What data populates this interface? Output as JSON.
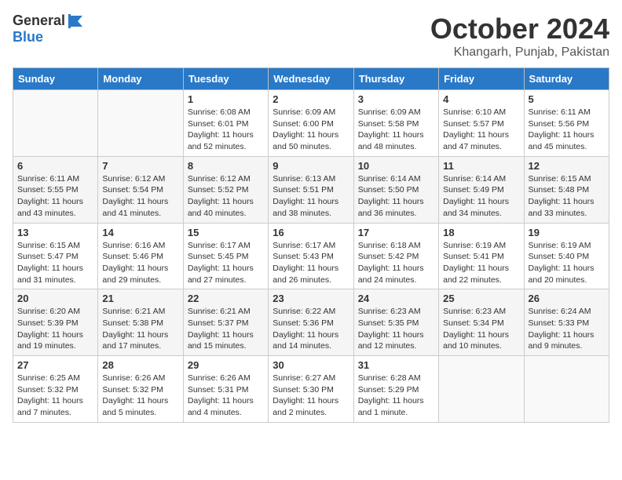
{
  "header": {
    "logo_general": "General",
    "logo_blue": "Blue",
    "month_title": "October 2024",
    "subtitle": "Khangarh, Punjab, Pakistan"
  },
  "days_of_week": [
    "Sunday",
    "Monday",
    "Tuesday",
    "Wednesday",
    "Thursday",
    "Friday",
    "Saturday"
  ],
  "weeks": [
    [
      {
        "day": "",
        "sunrise": "",
        "sunset": "",
        "daylight": "",
        "empty": true
      },
      {
        "day": "",
        "sunrise": "",
        "sunset": "",
        "daylight": "",
        "empty": true
      },
      {
        "day": "1",
        "sunrise": "Sunrise: 6:08 AM",
        "sunset": "Sunset: 6:01 PM",
        "daylight": "Daylight: 11 hours and 52 minutes.",
        "empty": false
      },
      {
        "day": "2",
        "sunrise": "Sunrise: 6:09 AM",
        "sunset": "Sunset: 6:00 PM",
        "daylight": "Daylight: 11 hours and 50 minutes.",
        "empty": false
      },
      {
        "day": "3",
        "sunrise": "Sunrise: 6:09 AM",
        "sunset": "Sunset: 5:58 PM",
        "daylight": "Daylight: 11 hours and 48 minutes.",
        "empty": false
      },
      {
        "day": "4",
        "sunrise": "Sunrise: 6:10 AM",
        "sunset": "Sunset: 5:57 PM",
        "daylight": "Daylight: 11 hours and 47 minutes.",
        "empty": false
      },
      {
        "day": "5",
        "sunrise": "Sunrise: 6:11 AM",
        "sunset": "Sunset: 5:56 PM",
        "daylight": "Daylight: 11 hours and 45 minutes.",
        "empty": false
      }
    ],
    [
      {
        "day": "6",
        "sunrise": "Sunrise: 6:11 AM",
        "sunset": "Sunset: 5:55 PM",
        "daylight": "Daylight: 11 hours and 43 minutes.",
        "empty": false
      },
      {
        "day": "7",
        "sunrise": "Sunrise: 6:12 AM",
        "sunset": "Sunset: 5:54 PM",
        "daylight": "Daylight: 11 hours and 41 minutes.",
        "empty": false
      },
      {
        "day": "8",
        "sunrise": "Sunrise: 6:12 AM",
        "sunset": "Sunset: 5:52 PM",
        "daylight": "Daylight: 11 hours and 40 minutes.",
        "empty": false
      },
      {
        "day": "9",
        "sunrise": "Sunrise: 6:13 AM",
        "sunset": "Sunset: 5:51 PM",
        "daylight": "Daylight: 11 hours and 38 minutes.",
        "empty": false
      },
      {
        "day": "10",
        "sunrise": "Sunrise: 6:14 AM",
        "sunset": "Sunset: 5:50 PM",
        "daylight": "Daylight: 11 hours and 36 minutes.",
        "empty": false
      },
      {
        "day": "11",
        "sunrise": "Sunrise: 6:14 AM",
        "sunset": "Sunset: 5:49 PM",
        "daylight": "Daylight: 11 hours and 34 minutes.",
        "empty": false
      },
      {
        "day": "12",
        "sunrise": "Sunrise: 6:15 AM",
        "sunset": "Sunset: 5:48 PM",
        "daylight": "Daylight: 11 hours and 33 minutes.",
        "empty": false
      }
    ],
    [
      {
        "day": "13",
        "sunrise": "Sunrise: 6:15 AM",
        "sunset": "Sunset: 5:47 PM",
        "daylight": "Daylight: 11 hours and 31 minutes.",
        "empty": false
      },
      {
        "day": "14",
        "sunrise": "Sunrise: 6:16 AM",
        "sunset": "Sunset: 5:46 PM",
        "daylight": "Daylight: 11 hours and 29 minutes.",
        "empty": false
      },
      {
        "day": "15",
        "sunrise": "Sunrise: 6:17 AM",
        "sunset": "Sunset: 5:45 PM",
        "daylight": "Daylight: 11 hours and 27 minutes.",
        "empty": false
      },
      {
        "day": "16",
        "sunrise": "Sunrise: 6:17 AM",
        "sunset": "Sunset: 5:43 PM",
        "daylight": "Daylight: 11 hours and 26 minutes.",
        "empty": false
      },
      {
        "day": "17",
        "sunrise": "Sunrise: 6:18 AM",
        "sunset": "Sunset: 5:42 PM",
        "daylight": "Daylight: 11 hours and 24 minutes.",
        "empty": false
      },
      {
        "day": "18",
        "sunrise": "Sunrise: 6:19 AM",
        "sunset": "Sunset: 5:41 PM",
        "daylight": "Daylight: 11 hours and 22 minutes.",
        "empty": false
      },
      {
        "day": "19",
        "sunrise": "Sunrise: 6:19 AM",
        "sunset": "Sunset: 5:40 PM",
        "daylight": "Daylight: 11 hours and 20 minutes.",
        "empty": false
      }
    ],
    [
      {
        "day": "20",
        "sunrise": "Sunrise: 6:20 AM",
        "sunset": "Sunset: 5:39 PM",
        "daylight": "Daylight: 11 hours and 19 minutes.",
        "empty": false
      },
      {
        "day": "21",
        "sunrise": "Sunrise: 6:21 AM",
        "sunset": "Sunset: 5:38 PM",
        "daylight": "Daylight: 11 hours and 17 minutes.",
        "empty": false
      },
      {
        "day": "22",
        "sunrise": "Sunrise: 6:21 AM",
        "sunset": "Sunset: 5:37 PM",
        "daylight": "Daylight: 11 hours and 15 minutes.",
        "empty": false
      },
      {
        "day": "23",
        "sunrise": "Sunrise: 6:22 AM",
        "sunset": "Sunset: 5:36 PM",
        "daylight": "Daylight: 11 hours and 14 minutes.",
        "empty": false
      },
      {
        "day": "24",
        "sunrise": "Sunrise: 6:23 AM",
        "sunset": "Sunset: 5:35 PM",
        "daylight": "Daylight: 11 hours and 12 minutes.",
        "empty": false
      },
      {
        "day": "25",
        "sunrise": "Sunrise: 6:23 AM",
        "sunset": "Sunset: 5:34 PM",
        "daylight": "Daylight: 11 hours and 10 minutes.",
        "empty": false
      },
      {
        "day": "26",
        "sunrise": "Sunrise: 6:24 AM",
        "sunset": "Sunset: 5:33 PM",
        "daylight": "Daylight: 11 hours and 9 minutes.",
        "empty": false
      }
    ],
    [
      {
        "day": "27",
        "sunrise": "Sunrise: 6:25 AM",
        "sunset": "Sunset: 5:32 PM",
        "daylight": "Daylight: 11 hours and 7 minutes.",
        "empty": false
      },
      {
        "day": "28",
        "sunrise": "Sunrise: 6:26 AM",
        "sunset": "Sunset: 5:32 PM",
        "daylight": "Daylight: 11 hours and 5 minutes.",
        "empty": false
      },
      {
        "day": "29",
        "sunrise": "Sunrise: 6:26 AM",
        "sunset": "Sunset: 5:31 PM",
        "daylight": "Daylight: 11 hours and 4 minutes.",
        "empty": false
      },
      {
        "day": "30",
        "sunrise": "Sunrise: 6:27 AM",
        "sunset": "Sunset: 5:30 PM",
        "daylight": "Daylight: 11 hours and 2 minutes.",
        "empty": false
      },
      {
        "day": "31",
        "sunrise": "Sunrise: 6:28 AM",
        "sunset": "Sunset: 5:29 PM",
        "daylight": "Daylight: 11 hours and 1 minute.",
        "empty": false
      },
      {
        "day": "",
        "sunrise": "",
        "sunset": "",
        "daylight": "",
        "empty": true
      },
      {
        "day": "",
        "sunrise": "",
        "sunset": "",
        "daylight": "",
        "empty": true
      }
    ]
  ]
}
